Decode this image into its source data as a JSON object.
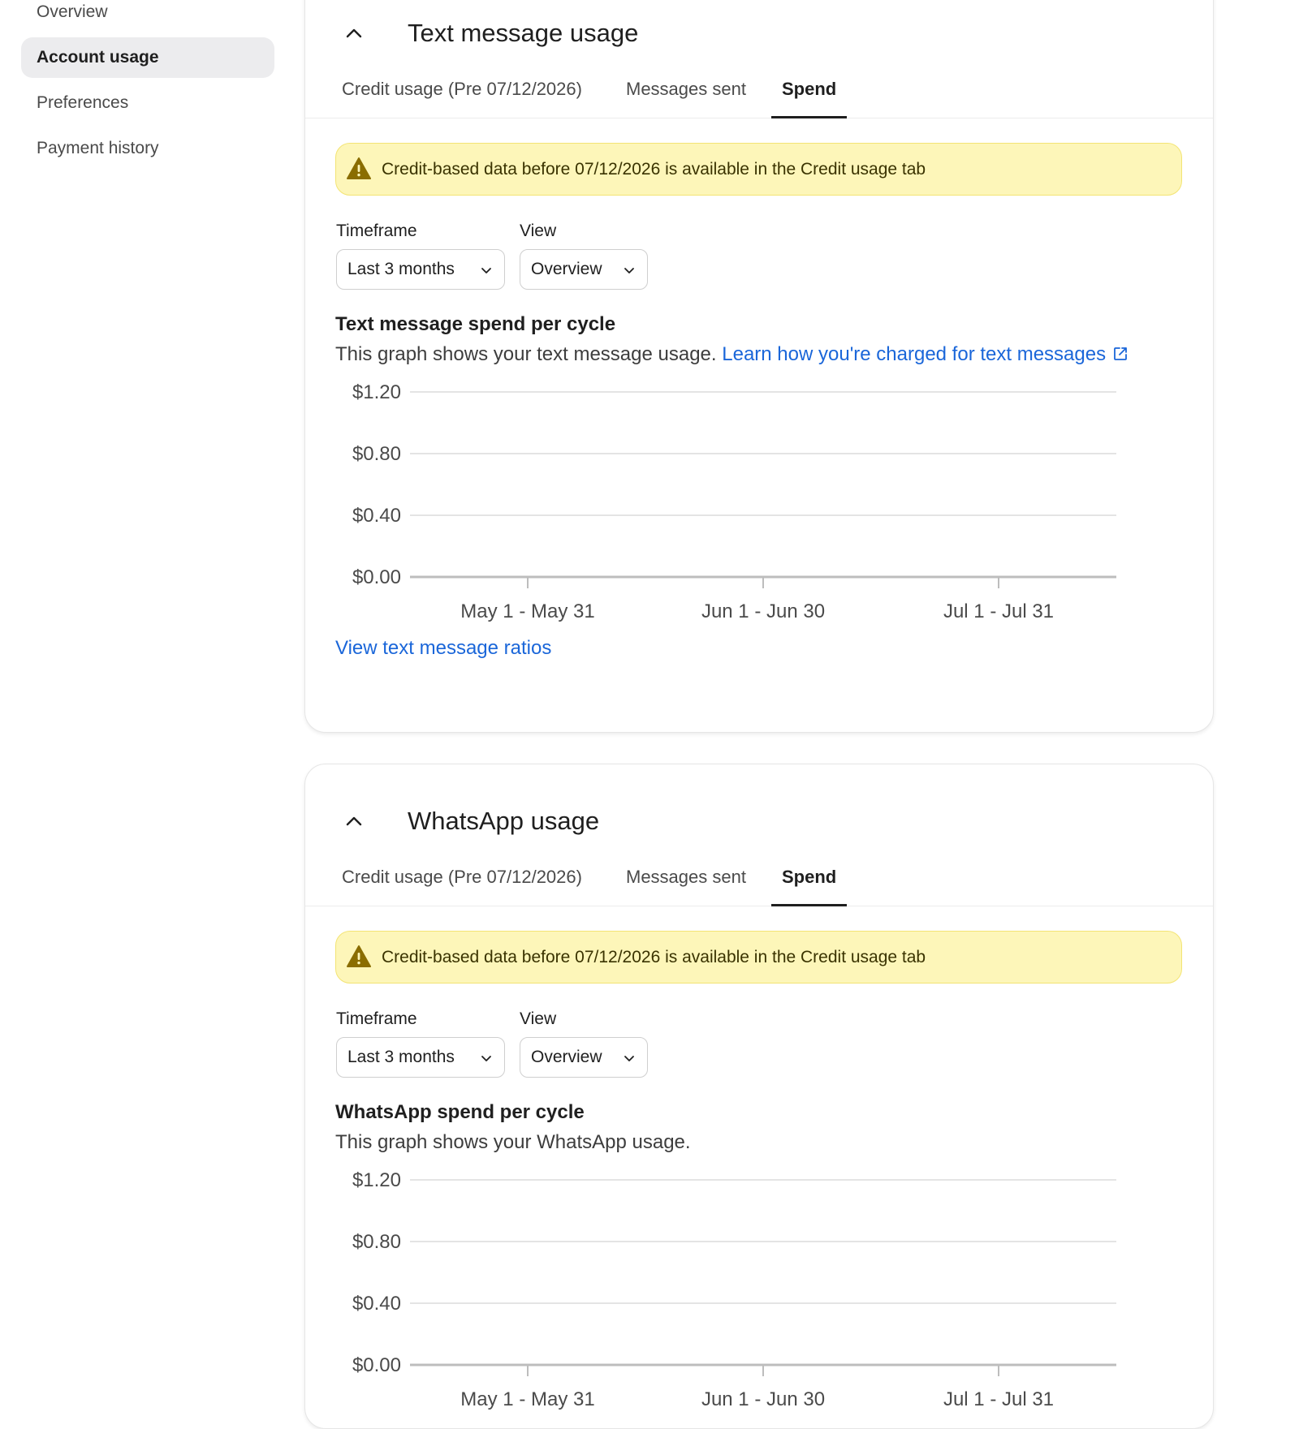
{
  "sidebar": {
    "items": [
      {
        "label": "Overview",
        "active": false
      },
      {
        "label": "Account usage",
        "active": true
      },
      {
        "label": "Preferences",
        "active": false
      },
      {
        "label": "Payment history",
        "active": false
      }
    ]
  },
  "text_card": {
    "title": "Text message usage",
    "tabs": [
      "Credit usage (Pre 07/12/2026)",
      "Messages sent",
      "Spend"
    ],
    "active_tab": "Spend",
    "banner": "Credit-based data before 07/12/2026 is available in the Credit usage tab",
    "timeframe_label": "Timeframe",
    "timeframe_value": "Last 3 months",
    "view_label": "View",
    "view_value": "Overview",
    "chart_title": "Text message spend per cycle",
    "chart_desc": "This graph shows your text message usage.",
    "chart_link": "Learn how you're charged for text messages",
    "footer_link": "View text message ratios"
  },
  "whatsapp_card": {
    "title": "WhatsApp usage",
    "tabs": [
      "Credit usage (Pre 07/12/2026)",
      "Messages sent",
      "Spend"
    ],
    "active_tab": "Spend",
    "banner": "Credit-based data before 07/12/2026 is available in the Credit usage tab",
    "timeframe_label": "Timeframe",
    "timeframe_value": "Last 3 months",
    "view_label": "View",
    "view_value": "Overview",
    "chart_title": "WhatsApp spend per cycle",
    "chart_desc": "This graph shows your WhatsApp usage."
  },
  "colors": {
    "accent_link": "#1a66d9",
    "banner_bg": "#fdf6b9",
    "warning_icon": "#8a6d00"
  },
  "icons": {
    "collapse": "chevron-up-icon",
    "dropdown": "chevron-down-icon",
    "warning": "warning-triangle-icon",
    "external": "external-link-icon"
  },
  "chart_data": [
    {
      "type": "bar",
      "categories": [
        "May 1 - May 31",
        "Jun 1 - Jun 30",
        "Jul 1 - Jul 31"
      ],
      "values": [
        0,
        0,
        0
      ],
      "yticks": [
        "$0.00",
        "$0.40",
        "$0.80",
        "$1.20"
      ],
      "ylim": [
        0,
        1.2
      ],
      "grid": true
    },
    {
      "type": "bar",
      "categories": [
        "May 1 - May 31",
        "Jun 1 - Jun 30",
        "Jul 1 - Jul 31"
      ],
      "values": [
        0,
        0,
        0
      ],
      "yticks": [
        "$0.00",
        "$0.40",
        "$0.80",
        "$1.20"
      ],
      "ylim": [
        0,
        1.2
      ],
      "grid": true
    }
  ]
}
